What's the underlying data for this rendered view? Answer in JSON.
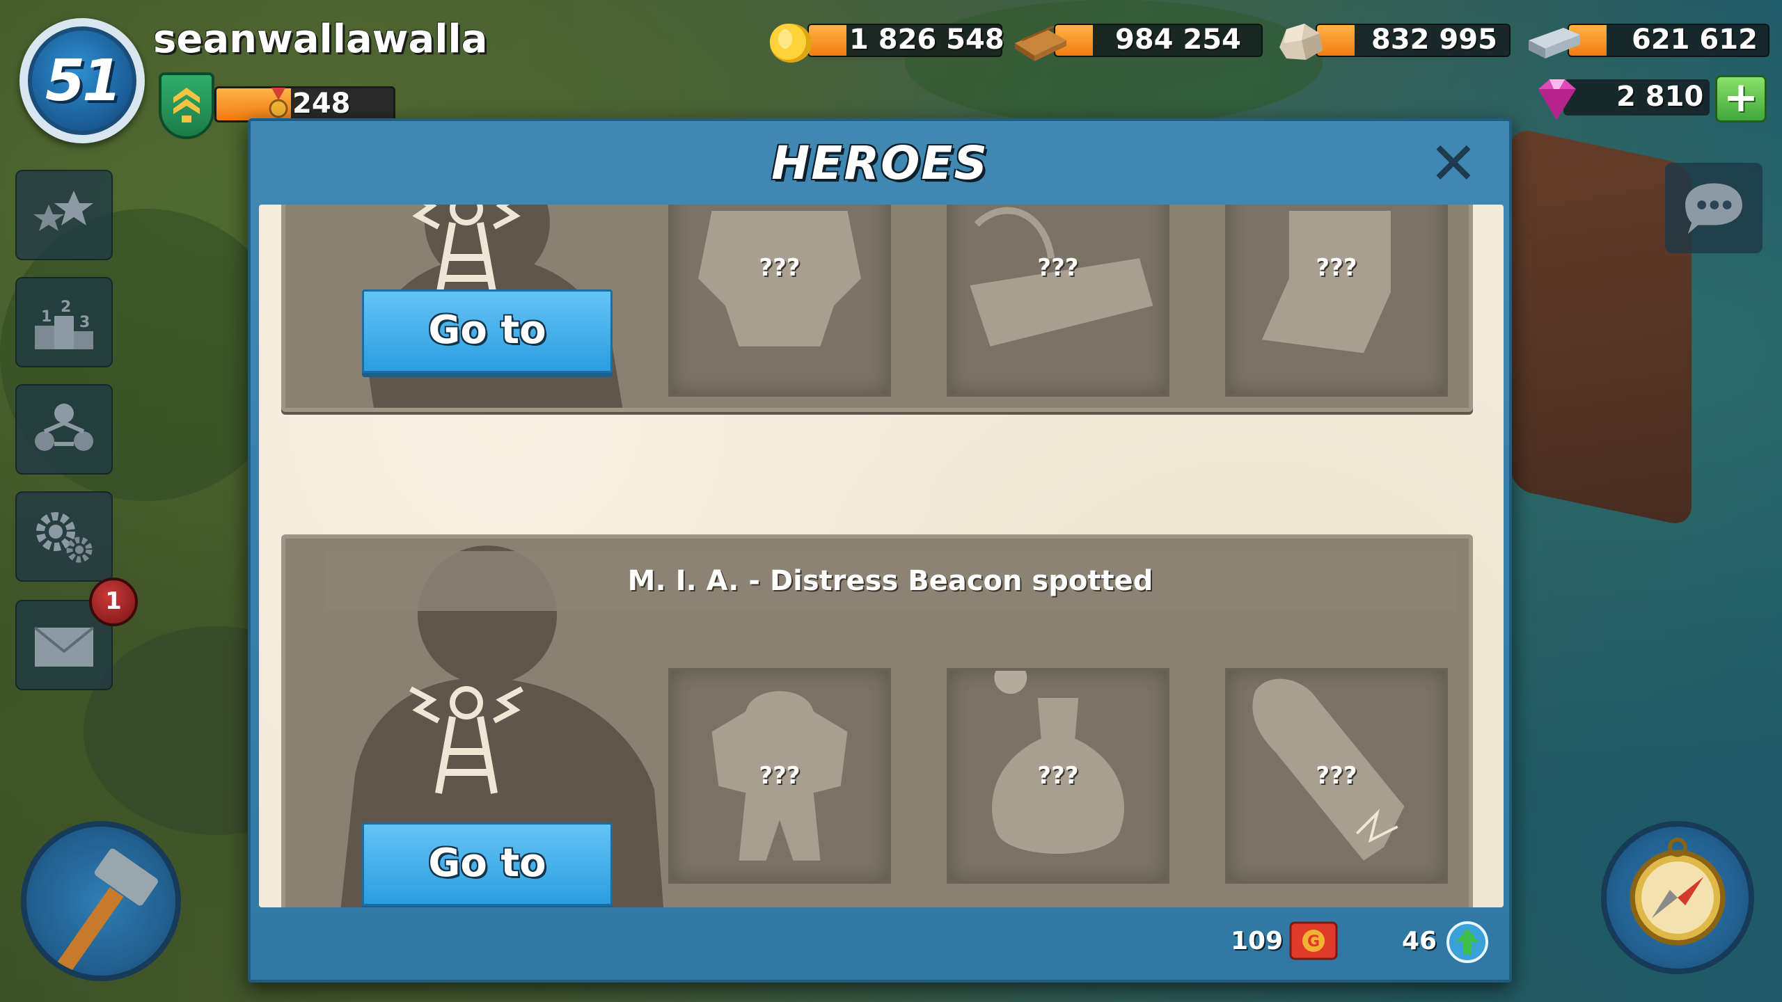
{
  "player": {
    "level": "51",
    "name": "seanwallawalla",
    "xp_value": "248",
    "xp_progress": 0.42
  },
  "resources": {
    "gold": "1 826 548",
    "wood": "984 254",
    "stone": "832 995",
    "iron": "621 612",
    "diamonds": "2 810"
  },
  "sidebar": {
    "mail_notifications": "1"
  },
  "dialog": {
    "title": "HEROES",
    "close_symbol": "✕",
    "cards": [
      {
        "caption": "",
        "button_label": "Go to",
        "rewards": [
          "???",
          "???",
          "???"
        ]
      },
      {
        "caption": "M. I. A. - Distress Beacon spotted",
        "button_label": "Go to",
        "rewards": [
          "???",
          "???",
          "???"
        ]
      }
    ],
    "footer": {
      "tokens": "109",
      "upgrades": "46"
    }
  },
  "icons": {
    "gold": "gold-coin-icon",
    "wood": "wood-planks-icon",
    "stone": "stone-icon",
    "iron": "iron-bar-icon",
    "diamonds": "gem-icon"
  },
  "colors": {
    "dialog_blue": "#3f89b3",
    "button_blue": "#2c9ee0",
    "card_gray": "#8a8172",
    "resource_orange": "#f07c12",
    "gem_pink": "#e04ab8"
  }
}
